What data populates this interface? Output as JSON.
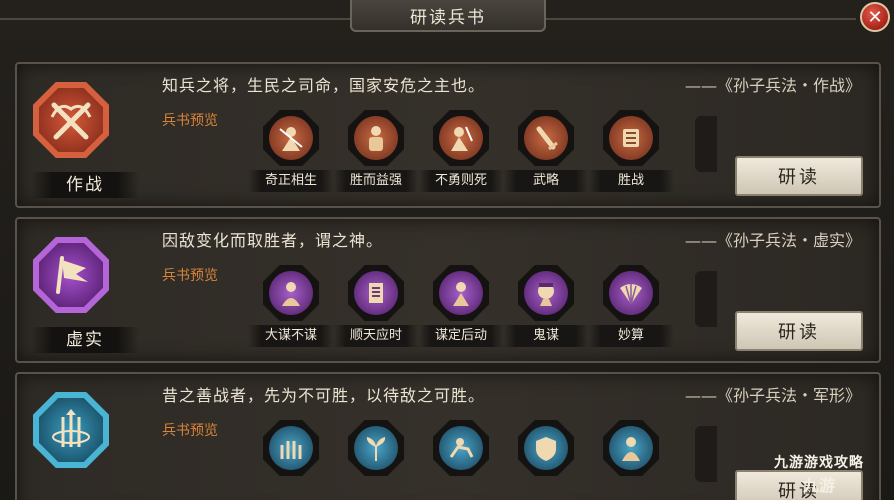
{
  "window": {
    "title": "研读兵书",
    "close_symbol": "✕"
  },
  "common": {
    "preview_label": "兵书预览",
    "study_button": "研读"
  },
  "books": [
    {
      "badge_label": "作战",
      "badge_color": "#b8402c",
      "badge_icon": "crossed-swords-icon",
      "quote": "知兵之将，生民之司命，国家安危之主也。",
      "source": "——《孙子兵法・作战》",
      "skills": [
        {
          "name": "奇正相生",
          "icon": "warrior-icon"
        },
        {
          "name": "胜而益强",
          "icon": "general-icon"
        },
        {
          "name": "不勇则死",
          "icon": "warrior-icon"
        },
        {
          "name": "武略",
          "icon": "sword-icon"
        },
        {
          "name": "胜战",
          "icon": "banner-icon"
        }
      ],
      "skill_color": "#b84a2e"
    },
    {
      "badge_label": "虚实",
      "badge_color": "#8a3cb0",
      "badge_icon": "flag-icon",
      "quote": "因敌变化而取胜者，谓之神。",
      "source": "——《孙子兵法・虚实》",
      "skills": [
        {
          "name": "大谋不谋",
          "icon": "strategist-icon"
        },
        {
          "name": "顺天应时",
          "icon": "scroll-icon"
        },
        {
          "name": "谋定后动",
          "icon": "strategist-icon"
        },
        {
          "name": "鬼谋",
          "icon": "mask-icon"
        },
        {
          "name": "妙算",
          "icon": "fan-icon"
        }
      ],
      "skill_color": "#8c44b4"
    },
    {
      "badge_label": "",
      "badge_color": "#2f8fb0",
      "badge_icon": "arrows-shield-icon",
      "quote": "昔之善战者，先为不可胜，以待敌之可胜。",
      "source": "——《孙子兵法・军形》",
      "skills": [
        {
          "name": "",
          "icon": "army-icon"
        },
        {
          "name": "",
          "icon": "plant-icon"
        },
        {
          "name": "",
          "icon": "cavalry-icon"
        },
        {
          "name": "",
          "icon": "shield-icon"
        },
        {
          "name": "",
          "icon": "monk-icon"
        }
      ],
      "skill_color": "#3a90b4"
    }
  ],
  "watermark": {
    "line1": "九游游戏攻略",
    "line2": "九游"
  }
}
